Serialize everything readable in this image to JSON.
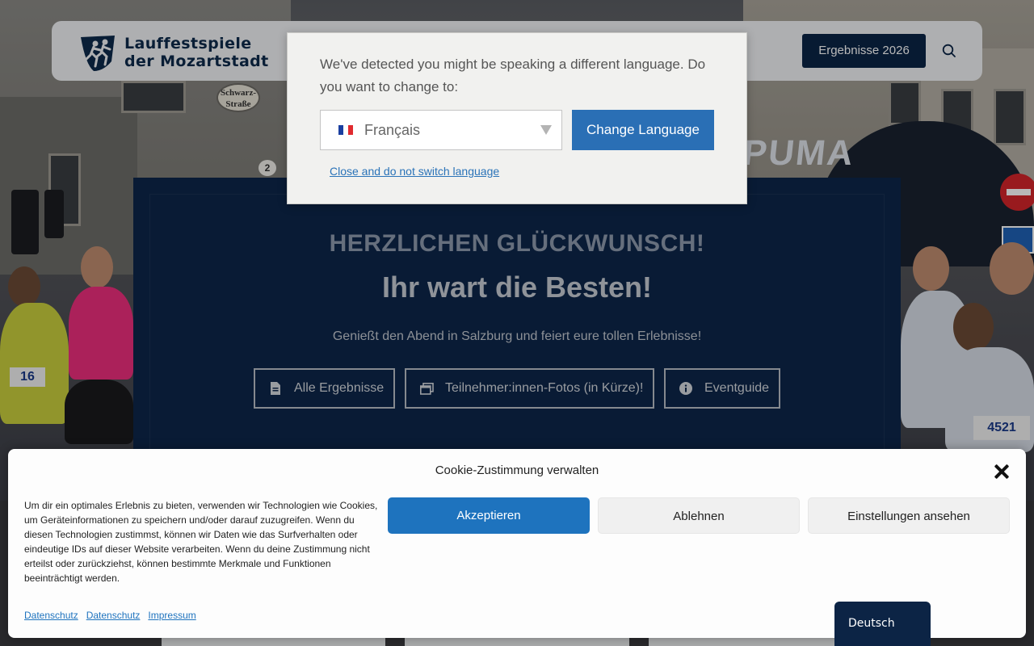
{
  "header": {
    "logo_line1": "Lauffestspiele",
    "logo_line2": "der Mozartstadt",
    "results_button": "Ergebnisse 2026",
    "search_icon": "search-icon"
  },
  "background": {
    "street_sign": "Schwarz-Straße",
    "house_number": "2",
    "arch_text": "PUMA",
    "bib_number": "4521",
    "bib_left": "16"
  },
  "hero": {
    "kicker": "HERZLICHEN GLÜCKWUNSCH!",
    "title": "Ihr wart die Besten!",
    "subtitle": "Genießt den Abend in Salzburg und feiert eure tollen Erlebnisse!",
    "buttons": [
      {
        "label": "Alle Ergebnisse",
        "icon": "document-icon"
      },
      {
        "label": "Teilnehmer:innen-Fotos (in Kürze)!",
        "icon": "gallery-icon"
      },
      {
        "label": "Eventguide",
        "icon": "info-icon"
      }
    ]
  },
  "language_modal": {
    "message": "We've detected you might be speaking a different language. Do you want to change to:",
    "selected_language": "Français",
    "change_button": "Change Language",
    "close_link": "Close and do not switch language"
  },
  "cookie_banner": {
    "title": "Cookie-Zustimmung verwalten",
    "text": "Um dir ein optimales Erlebnis zu bieten, verwenden wir Technologien wie Cookies, um Geräteinformationen zu speichern und/oder darauf zuzugreifen. Wenn du diesen Technologien zustimmst, können wir Daten wie das Surfverhalten oder eindeutige IDs auf dieser Website verarbeiten. Wenn du deine Zustimmung nicht erteilst oder zurückziehst, können bestimmte Merkmale und Funktionen beeinträchtigt werden.",
    "accept": "Akzeptieren",
    "deny": "Ablehnen",
    "preferences": "Einstellungen ansehen",
    "links": [
      "Datenschutz",
      "Datenschutz",
      "Impressum"
    ]
  },
  "language_switcher": {
    "current": "Deutsch"
  },
  "colors": {
    "brand_navy": "#0b2446",
    "hero_bg": "#0d264a",
    "accept_blue": "#1e73be",
    "change_blue": "#2a6fb5"
  }
}
